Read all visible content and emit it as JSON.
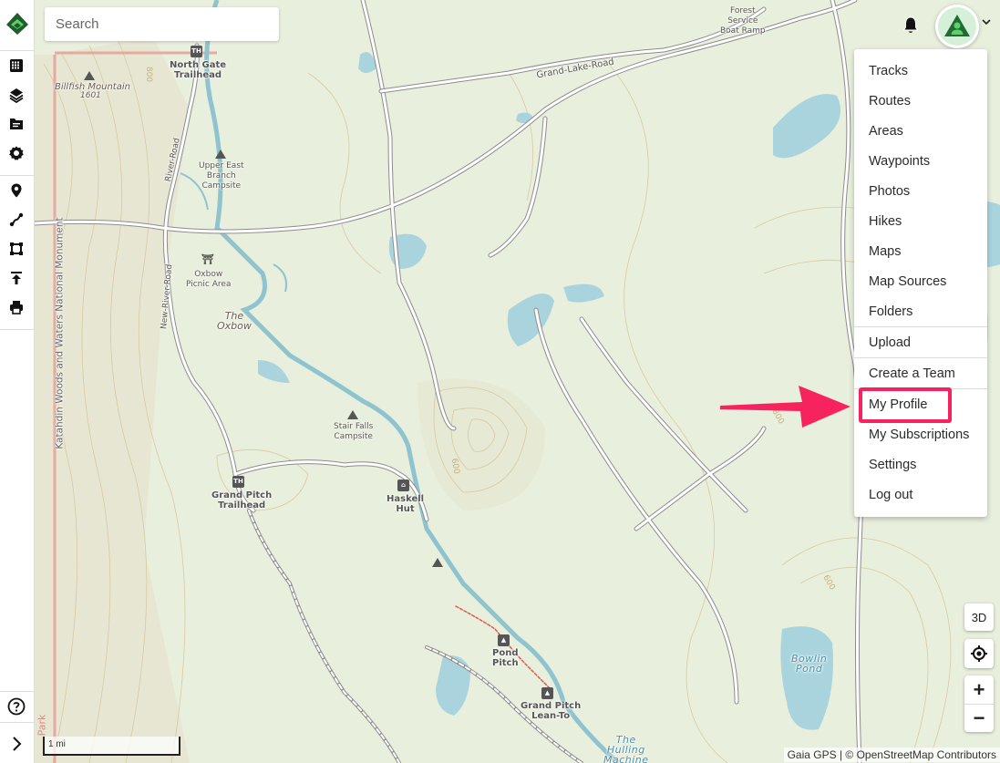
{
  "app": {
    "name": "Gaia GPS"
  },
  "search": {
    "placeholder": "Search",
    "value": ""
  },
  "sidebar": {
    "items": [
      {
        "name": "calendar-grid-icon",
        "label": "Grid"
      },
      {
        "name": "layers-icon",
        "label": "Layers"
      },
      {
        "name": "folder-icon",
        "label": "Saved items"
      },
      {
        "name": "gear-icon",
        "label": "Settings"
      },
      {
        "name": "map-pin-icon",
        "label": "Add waypoint"
      },
      {
        "name": "route-icon",
        "label": "Create route"
      },
      {
        "name": "area-icon",
        "label": "Create area"
      },
      {
        "name": "upload-icon",
        "label": "Upload"
      },
      {
        "name": "print-icon",
        "label": "Print"
      }
    ],
    "help_label": "Help",
    "expand_label": "Expand"
  },
  "header": {
    "notifications_label": "Notifications",
    "account_label": "Account menu"
  },
  "account_menu": {
    "groups": [
      [
        "Tracks",
        "Routes",
        "Areas",
        "Waypoints",
        "Photos",
        "Hikes",
        "Maps",
        "Map Sources",
        "Folders"
      ],
      [
        "Upload"
      ],
      [
        "Create a Team"
      ],
      [
        "My Profile",
        "My Subscriptions",
        "Settings",
        "Log out"
      ]
    ],
    "highlighted_item": "My Profile"
  },
  "map_controls": {
    "terrain_3d": "3D",
    "locate_label": "Locate me",
    "zoom_in": "+",
    "zoom_out": "−"
  },
  "scale": {
    "label": "1 mi"
  },
  "attribution": "Gaia GPS | © OpenStreetMap Contributors",
  "map_labels": {
    "billfish": "Billfish Mountain",
    "billfish_elev": "1601",
    "north_gate": "North Gate\nTrailhead",
    "upper_east": "Upper East\nBranch\nCampsite",
    "river_road": "River-Road",
    "new_river_road": "New-River-Road",
    "oxbow_picnic": "Oxbow\nPicnic Area",
    "the_oxbow": "The\nOxbow",
    "katahdin": "Katahdin Woods and Waters National Monument",
    "stair_falls": "Stair Falls\nCampsite",
    "grand_pitch_th": "Grand Pitch\nTrailhead",
    "haskell_hut": "Haskell\nHut",
    "pond_pitch": "Pond\nPitch",
    "grand_pitch_lean": "Grand Pitch\nLean-To",
    "hulling": "The\nHulling\nMachine",
    "grand_lake_road": "Grand-Lake-Road",
    "forest_service": "Forest\nService\nBoat Ramp",
    "bowlin_pond": "Bowlin\nPond",
    "park_edge": "Park",
    "contour_800": "800",
    "contour_600": "600"
  },
  "colors": {
    "brand_green": "#2e8b3e",
    "highlight": "#f7235f",
    "map_bg": "#e8efdc",
    "water": "#a9d4de"
  }
}
